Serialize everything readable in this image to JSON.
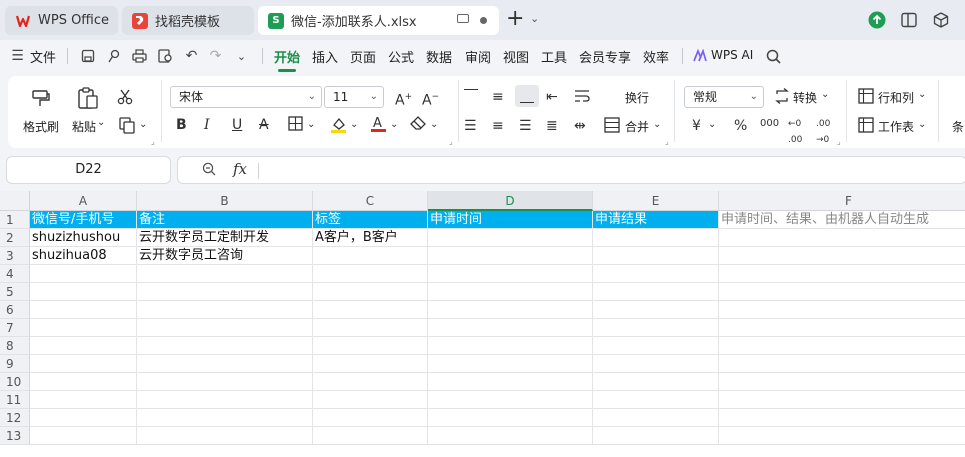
{
  "tabs": [
    {
      "label": "WPS Office"
    },
    {
      "label": "找稻壳模板"
    },
    {
      "label": "微信-添加联系人.xlsx"
    }
  ],
  "menu": {
    "file": "文件",
    "items": [
      "开始",
      "插入",
      "页面",
      "公式",
      "数据",
      "审阅",
      "视图",
      "工具",
      "会员专享",
      "效率"
    ],
    "wps_ai": "WPS AI"
  },
  "ribbon": {
    "format_painter": "格式刷",
    "paste": "粘贴",
    "font_name": "宋体",
    "font_size": "11",
    "wrap": "换行",
    "merge": "合并",
    "number_format": "常规",
    "convert": "转换",
    "row_col": "行和列",
    "worksheet": "工作表",
    "cond": "条"
  },
  "formula_bar": {
    "name_box": "D22",
    "fx": "fx",
    "formula": ""
  },
  "grid": {
    "columns": [
      "A",
      "B",
      "C",
      "D",
      "E",
      "F"
    ],
    "selected_column": "D",
    "rows": [
      "1",
      "2",
      "3",
      "4",
      "5",
      "6",
      "7",
      "8",
      "9",
      "10",
      "11",
      "12",
      "13"
    ],
    "header_row": [
      "微信号/手机号",
      "备注",
      "标签",
      "申请时间",
      "申请结果",
      "申请时间、结果、由机器人自动生成"
    ],
    "data": [
      [
        "shuzizhushou",
        "云开数字员工定制开发",
        "A客户，B客户",
        "",
        "",
        ""
      ],
      [
        "shuzihua08",
        "云开数字员工咨询",
        "",
        "",
        "",
        ""
      ]
    ]
  },
  "colors": {
    "accent": "#1b8f4c",
    "header_fill": "#00b0ee"
  }
}
